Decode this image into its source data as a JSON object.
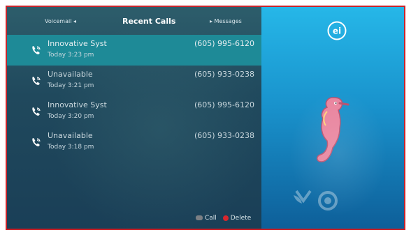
{
  "header": {
    "voicemail_label": "Voicemail ◂",
    "title": "Recent Calls",
    "messages_label": "▸ Messages"
  },
  "calls": [
    {
      "name": "Innovative Syst",
      "time": "Today 3:23 pm",
      "number": "(605) 995-6120",
      "selected": true
    },
    {
      "name": "Unavailable",
      "time": "Today 3:21 pm",
      "number": "(605) 933-0238",
      "selected": false
    },
    {
      "name": "Innovative Syst",
      "time": "Today 3:20 pm",
      "number": "(605) 995-6120",
      "selected": false
    },
    {
      "name": "Unavailable",
      "time": "Today 3:18 pm",
      "number": "(605) 933-0238",
      "selected": false
    }
  ],
  "footer": {
    "call_label": "Call",
    "delete_label": "Delete"
  },
  "brand": {
    "logo_text": "ei",
    "colors": {
      "selected_row": "#1e8a97",
      "delete_red": "#d7262d",
      "frame_red": "#c9242b"
    }
  },
  "icons": [
    "phone-icon",
    "ei-logo-icon",
    "seahorse-image",
    "network-logos"
  ]
}
